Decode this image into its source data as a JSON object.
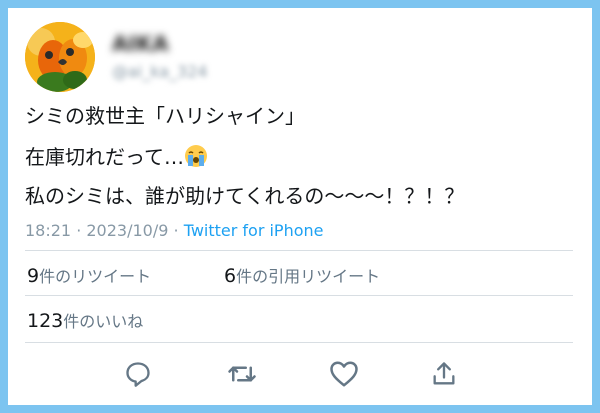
{
  "user": {
    "display_name": "AIKA",
    "handle": "@ai_ka_324"
  },
  "tweet": {
    "line1": "シミの救世主「ハリシャイン」",
    "line2": "在庫切れだって…",
    "line2_emoji": "loudly-crying-face-emoji",
    "line3": "私のシミは、誰が助けてくれるの〜〜〜！？！？"
  },
  "meta": {
    "time": "18:21",
    "separator1": " · ",
    "date": "2023/10/9",
    "separator2": " · ",
    "source": "Twitter for iPhone"
  },
  "stats": {
    "retweets_count": "9",
    "retweets_label": "件のリツイート",
    "quotes_count": "6",
    "quotes_label": "件の引用リツイート",
    "likes_count": "123",
    "likes_label": "件のいいね"
  },
  "actions": [
    "reply-icon",
    "retweet-icon",
    "like-icon",
    "share-icon"
  ],
  "colors": {
    "frame": "#7cc4f0",
    "link": "#1da1f2",
    "muted": "#8899a6",
    "icon": "#657786"
  }
}
